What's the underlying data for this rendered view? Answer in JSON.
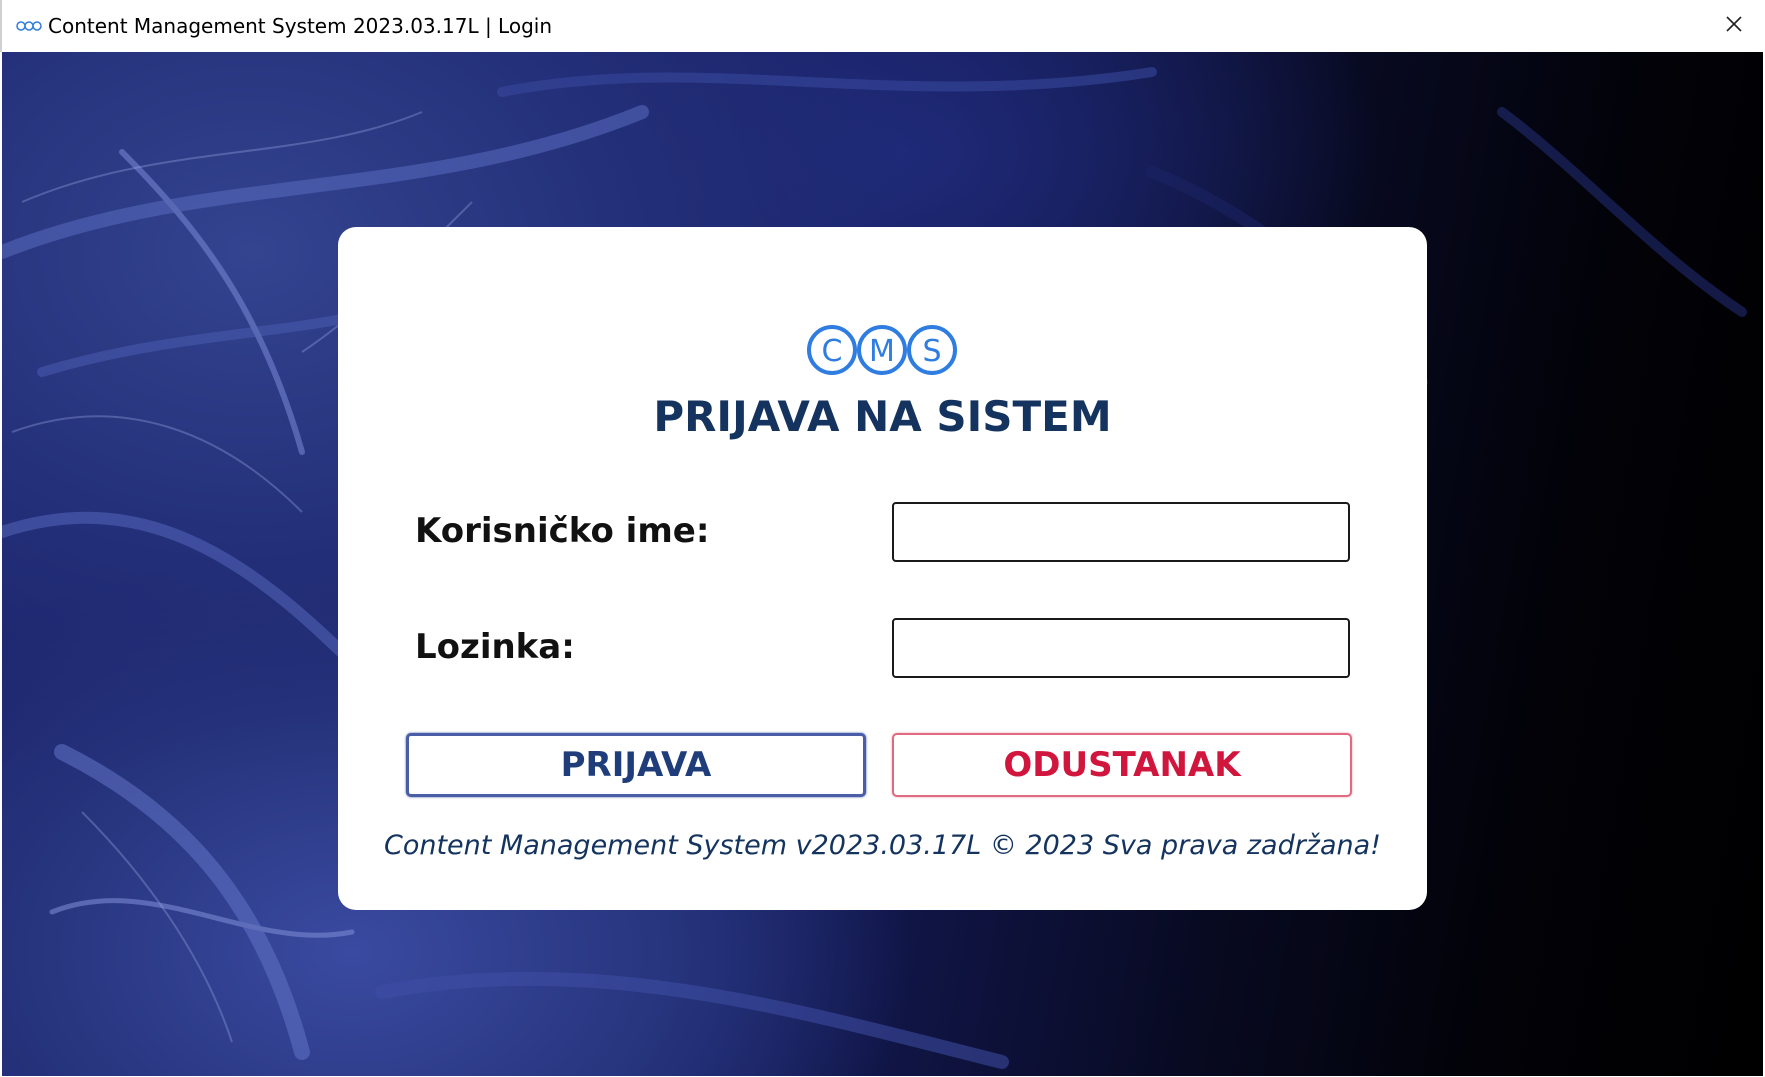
{
  "window": {
    "title": "Content Management System 2023.03.17L | Login",
    "app_icon": "cms-logo-icon",
    "close_icon": "close-icon"
  },
  "login_card": {
    "logo": {
      "letters": [
        "C",
        "M",
        "S"
      ],
      "icon": "cms-logo-icon",
      "color": "#2f7de1"
    },
    "heading": "PRIJAVA NA SISTEM",
    "username": {
      "label": "Korisničko ime:",
      "value": "",
      "placeholder": ""
    },
    "password": {
      "label": "Lozinka:",
      "value": "",
      "placeholder": ""
    },
    "login_button": {
      "label": "PRIJAVA",
      "color": "#1f3d7a"
    },
    "cancel_button": {
      "label": "ODUSTANAK",
      "color": "#d1163e"
    },
    "footer": "Content Management System v2023.03.17L © 2023 Sva prava zadržana!"
  },
  "colors": {
    "heading": "#14335e",
    "background_dark": "#000000",
    "background_blue": "#24307a",
    "card": "#ffffff"
  }
}
